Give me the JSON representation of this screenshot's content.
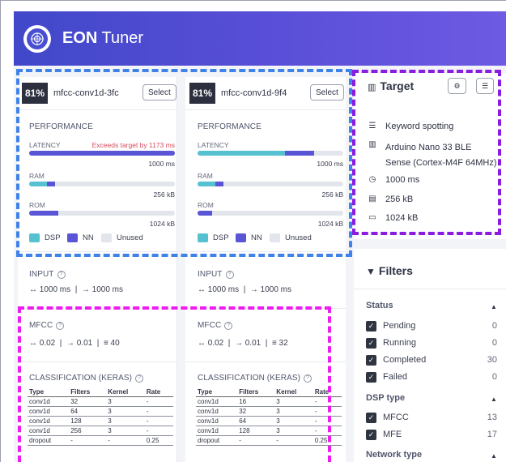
{
  "app": {
    "title_bold": "EON",
    "title_rest": " Tuner"
  },
  "colors": {
    "dsp": "#56c1d0",
    "nn": "#5a55d6",
    "unused": "#e3e5ec",
    "warning": "#d44b5c"
  },
  "models": [
    {
      "accuracy": "81%",
      "name": "mfcc-conv1d-3fc",
      "select_label": "Select",
      "performance_label": "PERFORMANCE",
      "latency_label": "LATENCY",
      "latency_warning": "Exceeds target by 1173 ms",
      "latency_max": "1000 ms",
      "latency_fill": {
        "dsp": 0.0,
        "nn": 1.0
      },
      "ram_label": "RAM",
      "ram_max": "256 kB",
      "ram_fill": {
        "dsp": 0.12,
        "nn": 0.06
      },
      "rom_label": "ROM",
      "rom_max": "1024 kB",
      "rom_fill": {
        "dsp": 0.0,
        "nn": 0.2
      },
      "legend": {
        "dsp": "DSP",
        "nn": "NN",
        "unused": "Unused"
      },
      "input_label": "INPUT",
      "input_window": "↔ 1000 ms",
      "input_stride": "→ 1000 ms",
      "dsp_label": "MFCC",
      "dsp_window": "↔ 0.02",
      "dsp_stride": "→ 0.01",
      "dsp_coeffs": "≡ 40",
      "classification_label": "CLASSIFICATION (KERAS)",
      "table_headers": [
        "Type",
        "Filters",
        "Kernel",
        "Rate"
      ],
      "table_rows": [
        [
          "conv1d",
          "32",
          "3",
          "-"
        ],
        [
          "conv1d",
          "64",
          "3",
          "-"
        ],
        [
          "conv1d",
          "128",
          "3",
          "-"
        ],
        [
          "conv1d",
          "256",
          "3",
          "-"
        ],
        [
          "dropout",
          "-",
          "-",
          "0.25"
        ]
      ]
    },
    {
      "accuracy": "81%",
      "name": "mfcc-conv1d-9f4",
      "select_label": "Select",
      "performance_label": "PERFORMANCE",
      "latency_label": "LATENCY",
      "latency_warning": "",
      "latency_max": "1000 ms",
      "latency_fill": {
        "dsp": 0.6,
        "nn": 0.2
      },
      "ram_label": "RAM",
      "ram_max": "256 kB",
      "ram_fill": {
        "dsp": 0.12,
        "nn": 0.06
      },
      "rom_label": "ROM",
      "rom_max": "1024 kB",
      "rom_fill": {
        "dsp": 0.0,
        "nn": 0.1
      },
      "legend": {
        "dsp": "DSP",
        "nn": "NN",
        "unused": "Unused"
      },
      "input_label": "INPUT",
      "input_window": "↔ 1000 ms",
      "input_stride": "→ 1000 ms",
      "dsp_label": "MFCC",
      "dsp_window": "↔ 0.02",
      "dsp_stride": "→ 0.01",
      "dsp_coeffs": "≡ 32",
      "classification_label": "CLASSIFICATION (KERAS)",
      "table_headers": [
        "Type",
        "Filters",
        "Kernel",
        "Rate"
      ],
      "table_rows": [
        [
          "conv1d",
          "16",
          "3",
          "-"
        ],
        [
          "conv1d",
          "32",
          "3",
          "-"
        ],
        [
          "conv1d",
          "64",
          "3",
          "-"
        ],
        [
          "conv1d",
          "128",
          "3",
          "-"
        ],
        [
          "dropout",
          "-",
          "-",
          "0.25"
        ]
      ]
    }
  ],
  "target": {
    "title": "Target",
    "rows": [
      {
        "icon": "database-icon",
        "text": "Keyword spotting"
      },
      {
        "icon": "chip-icon",
        "text": "Arduino Nano 33 BLE",
        "text2": "Sense (Cortex-M4F 64MHz)"
      },
      {
        "icon": "clock-icon",
        "text": "1000 ms"
      },
      {
        "icon": "ram-icon",
        "text": "256 kB"
      },
      {
        "icon": "rom-icon",
        "text": "1024 kB"
      }
    ]
  },
  "filters": {
    "title": "Filters",
    "status_label": "Status",
    "status_items": [
      {
        "label": "Pending",
        "count": "0"
      },
      {
        "label": "Running",
        "count": "0"
      },
      {
        "label": "Completed",
        "count": "30"
      },
      {
        "label": "Failed",
        "count": "0"
      }
    ],
    "dsp_label": "DSP type",
    "dsp_items": [
      {
        "label": "MFCC",
        "count": "13"
      },
      {
        "label": "MFE",
        "count": "17"
      }
    ],
    "network_label": "Network type"
  }
}
